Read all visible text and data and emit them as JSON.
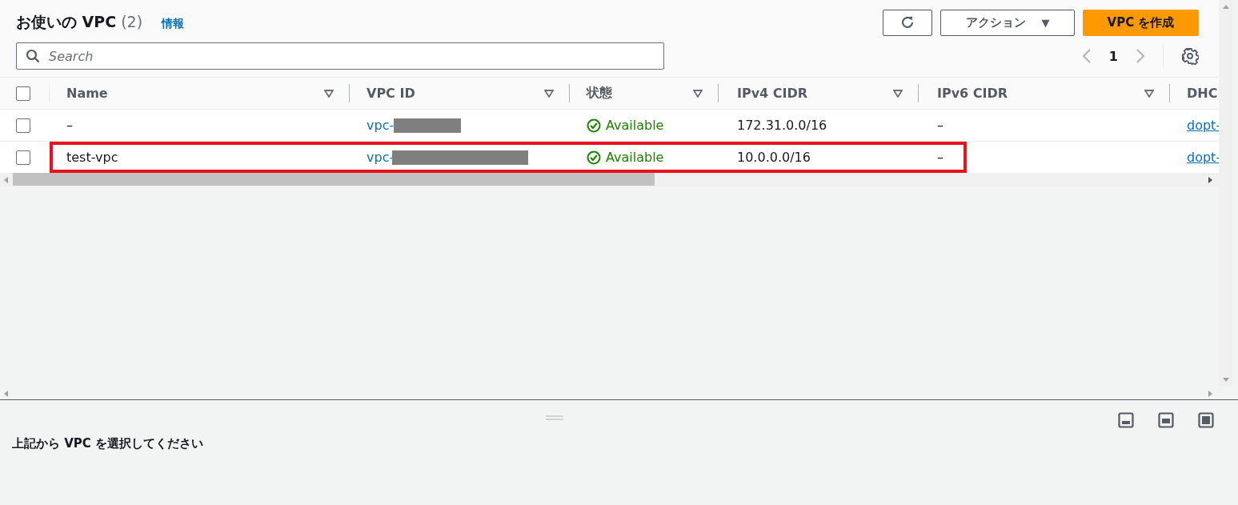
{
  "header": {
    "title": "お使いの VPC",
    "count": "(2)",
    "info_link": "情報"
  },
  "toolbar": {
    "actions_label": "アクション",
    "actions_caret": "▼",
    "create_label": "VPC を作成"
  },
  "search": {
    "placeholder": "Search"
  },
  "pagination": {
    "page": "1"
  },
  "table": {
    "select_all_checked": false,
    "columns": [
      {
        "label": "Name",
        "sortable": true
      },
      {
        "label": "VPC ID",
        "sortable": true
      },
      {
        "label": "状態",
        "sortable": true
      },
      {
        "label": "IPv4 CIDR",
        "sortable": true
      },
      {
        "label": "IPv6 CIDR",
        "sortable": true
      },
      {
        "label": "DHC",
        "sortable": false
      }
    ],
    "rows": [
      {
        "checked": false,
        "highlighted": false,
        "name": "–",
        "vpc_id": "vpc-",
        "status": "Available",
        "ipv4": "172.31.0.0/16",
        "ipv6": "–",
        "dhcp": "dopt-"
      },
      {
        "checked": false,
        "highlighted": true,
        "name": "test-vpc",
        "vpc_id": "vpc-",
        "status": "Available",
        "ipv4": "10.0.0.0/16",
        "ipv6": "–",
        "dhcp": "dopt-"
      }
    ]
  },
  "detail_panel": {
    "message": "上記から VPC を選択してください"
  }
}
